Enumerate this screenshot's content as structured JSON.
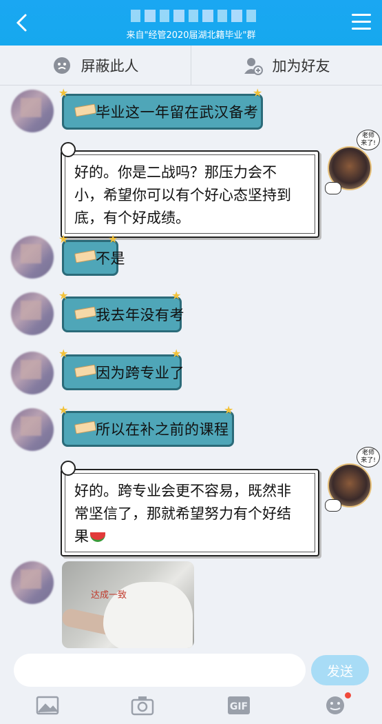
{
  "header": {
    "subtitle": "来自\"经管2020届湖北籍毕业\"群"
  },
  "actions": {
    "block_label": "屏蔽此人",
    "add_friend_label": "加为好友"
  },
  "messages": [
    {
      "side": "left",
      "text": "毕业这一年留在武汉备考"
    },
    {
      "side": "right",
      "text": "好的。你是二战吗？那压力会不小，希望你可以有个好心态坚持到底，有个好成绩。"
    },
    {
      "side": "left",
      "text": "不是"
    },
    {
      "side": "left",
      "text": "我去年没有考"
    },
    {
      "side": "left",
      "text": "因为跨专业了"
    },
    {
      "side": "left",
      "text": "所以在补之前的课程"
    },
    {
      "side": "right",
      "text": "好的。跨专业会更不容易，既然非常坚信了，那就希望努力有个好结果"
    },
    {
      "side": "left",
      "type": "image",
      "caption": "达成一致"
    }
  ],
  "teacher_tag": "老师来了",
  "input": {
    "placeholder": "",
    "send_label": "发送"
  },
  "toolbar": {
    "items": [
      "image-icon",
      "camera-icon",
      "gif-icon",
      "emoji-icon"
    ],
    "gif_label": "GIF"
  },
  "colors": {
    "header": "#16a8ee",
    "left_bubble": "#4fa6b8",
    "send_button": "#a8dcf6"
  }
}
